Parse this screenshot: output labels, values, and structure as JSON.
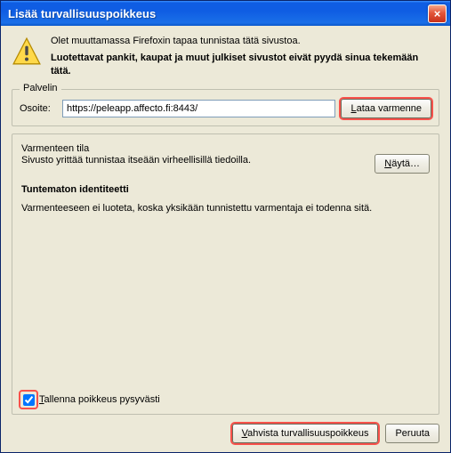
{
  "window": {
    "title": "Lisää turvallisuuspoikkeus",
    "close_label": "×"
  },
  "intro": {
    "line1": "Olet muuttamassa Firefoxin tapaa tunnistaa tätä sivustoa.",
    "line2": "Luotettavat pankit, kaupat ja muut julkiset sivustot eivät pyydä sinua tekemään tätä."
  },
  "server": {
    "legend": "Palvelin",
    "address_label": "Osoite:",
    "address_value": "https://peleapp.affecto.fi:8443/",
    "fetch_prefix": "L",
    "fetch_rest": "ataa varmenne"
  },
  "cert": {
    "legend": "Varmenteen tila",
    "status_line": "Sivusto yrittää tunnistaa itseään virheellisillä tiedoilla.",
    "view_prefix": "N",
    "view_rest": "äytä…",
    "heading": "Tuntematon identiteetti",
    "body": "Varmenteeseen ei luoteta, koska yksikään tunnistettu varmentaja ei todenna sitä."
  },
  "save": {
    "prefix": "T",
    "rest": "allenna poikkeus pysyvästi"
  },
  "footer": {
    "confirm_prefix": "V",
    "confirm_rest": "ahvista turvallisuuspoikkeus",
    "cancel": "Peruuta"
  }
}
